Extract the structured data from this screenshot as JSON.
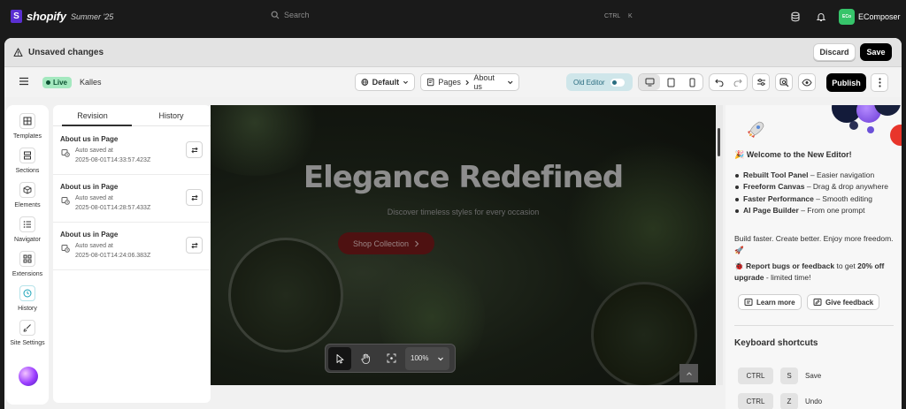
{
  "topbar": {
    "brand": "shopify",
    "edition": "Summer '25",
    "search_placeholder": "Search",
    "shortcut_mod": "CTRL",
    "shortcut_key": "K",
    "store_badge": "ECo",
    "store_name": "EComposer"
  },
  "unsaved_bar": {
    "title": "Unsaved changes",
    "discard_label": "Discard",
    "save_label": "Save"
  },
  "toolbar": {
    "status_label": "Live",
    "theme_name": "Kalles",
    "template_select": "Default",
    "page_crumb_root": "Pages",
    "page_crumb_current": "About us",
    "old_editor_label": "Old Editor",
    "publish_label": "Publish"
  },
  "rail": {
    "items": [
      {
        "label": "Templates",
        "icon": "layout-icon"
      },
      {
        "label": "Sections",
        "icon": "sections-icon"
      },
      {
        "label": "Elements",
        "icon": "cube-icon"
      },
      {
        "label": "Navigator",
        "icon": "list-icon"
      },
      {
        "label": "Extensions",
        "icon": "apps-icon"
      },
      {
        "label": "History",
        "icon": "clock-icon"
      },
      {
        "label": "Site Settings",
        "icon": "brush-icon"
      }
    ],
    "active": "History"
  },
  "history_panel": {
    "tabs": [
      "Revision",
      "History"
    ],
    "active_tab": "Revision",
    "revisions": [
      {
        "title": "About us in Page",
        "status": "Auto saved at",
        "timestamp": "2025-08-01T14:33:57.423Z"
      },
      {
        "title": "About us in Page",
        "status": "Auto saved at",
        "timestamp": "2025-08-01T14:28:57.433Z"
      },
      {
        "title": "About us in Page",
        "status": "Auto saved at",
        "timestamp": "2025-08-01T14:24:06.383Z"
      }
    ]
  },
  "canvas": {
    "hero_title": "Elegance Redefined",
    "hero_subtitle": "Discover timeless styles for every occasion",
    "hero_button": "Shop Collection",
    "zoom_level": "100%"
  },
  "right_panel": {
    "welcome": "Welcome to the New Editor!",
    "features": [
      {
        "bold": "Rebuilt Tool Panel",
        "rest": " – Easier navigation"
      },
      {
        "bold": "Freeform Canvas",
        "rest": " – Drag & drop anywhere"
      },
      {
        "bold": "Faster Performance",
        "rest": " – Smooth editing"
      },
      {
        "bold": "AI Page Builder",
        "rest": " – From one prompt"
      }
    ],
    "build_text": "Build faster. Create better. Enjoy more freedom. 🚀",
    "bugs_bold": "Report bugs or feedback",
    "bugs_mid": " to get ",
    "bugs_bold2": "20% off upgrade",
    "bugs_end": " - limited time!",
    "learn_more": "Learn more",
    "give_feedback": "Give feedback",
    "shortcuts_title": "Keyboard shortcuts",
    "shortcuts": [
      {
        "mod": "CTRL",
        "key": "S",
        "action": "Save"
      },
      {
        "mod": "CTRL",
        "key": "Z",
        "action": "Undo"
      }
    ]
  },
  "colors": {
    "live_badge_bg": "#a4e8bf",
    "store_badge_bg": "#36c46a",
    "publish_bg": "#000000",
    "hero_button_bg": "#4e1111"
  }
}
